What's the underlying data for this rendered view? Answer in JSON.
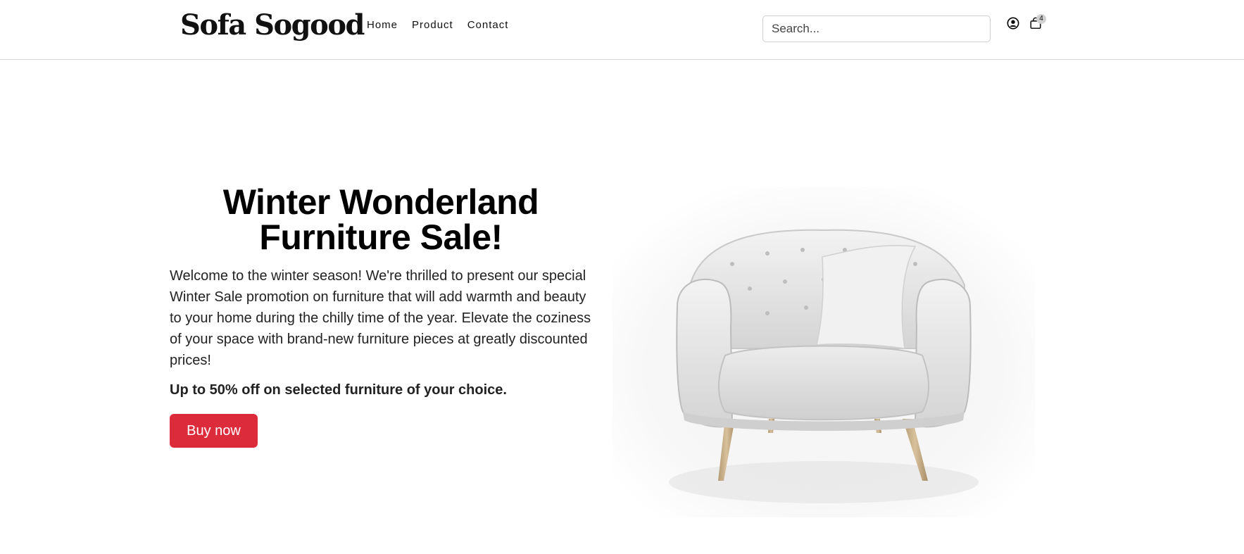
{
  "header": {
    "brand": "Sofa Sogood",
    "nav": [
      {
        "label": "Home"
      },
      {
        "label": "Product"
      },
      {
        "label": "Contact"
      }
    ],
    "search": {
      "placeholder": "Search...",
      "value": ""
    },
    "cart_count": "4",
    "icons": {
      "user": "user-circle-icon",
      "cart": "shopping-bag-icon"
    }
  },
  "hero": {
    "title_line1": "Winter Wonderland",
    "title_line2": "Furniture Sale!",
    "description": "Welcome to the winter season! We're thrilled to present our special Winter Sale promotion on furniture that will add warmth and beauty to your home during the chilly time of the year. Elevate the coziness of your space with brand-new furniture pieces at greatly discounted prices!",
    "offer": "Up to 50% off on selected furniture of your choice.",
    "cta_label": "Buy now",
    "image": "white-armchair-image"
  },
  "colors": {
    "accent": "#dc2c3c",
    "text": "#111111",
    "border": "#d9d9d9"
  }
}
